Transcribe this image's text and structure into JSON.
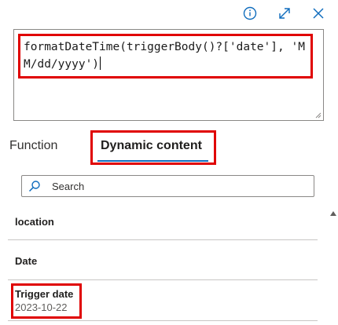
{
  "toolbar": {
    "icons": [
      "info-icon",
      "expand-icon",
      "close-icon"
    ],
    "accent": "#0f6cbd"
  },
  "editor": {
    "expression": "formatDateTime(triggerBody()?['date'], 'MM/dd/yyyy')"
  },
  "tabs": {
    "function_label": "Function",
    "dynamic_label": "Dynamic content",
    "selected": "Dynamic content"
  },
  "search": {
    "placeholder": "Search"
  },
  "list": {
    "items": [
      {
        "label": "location"
      },
      {
        "label": "Date"
      },
      {
        "label": "Trigger date",
        "value": "2023-10-22"
      }
    ]
  },
  "highlight_color": "#e00000"
}
